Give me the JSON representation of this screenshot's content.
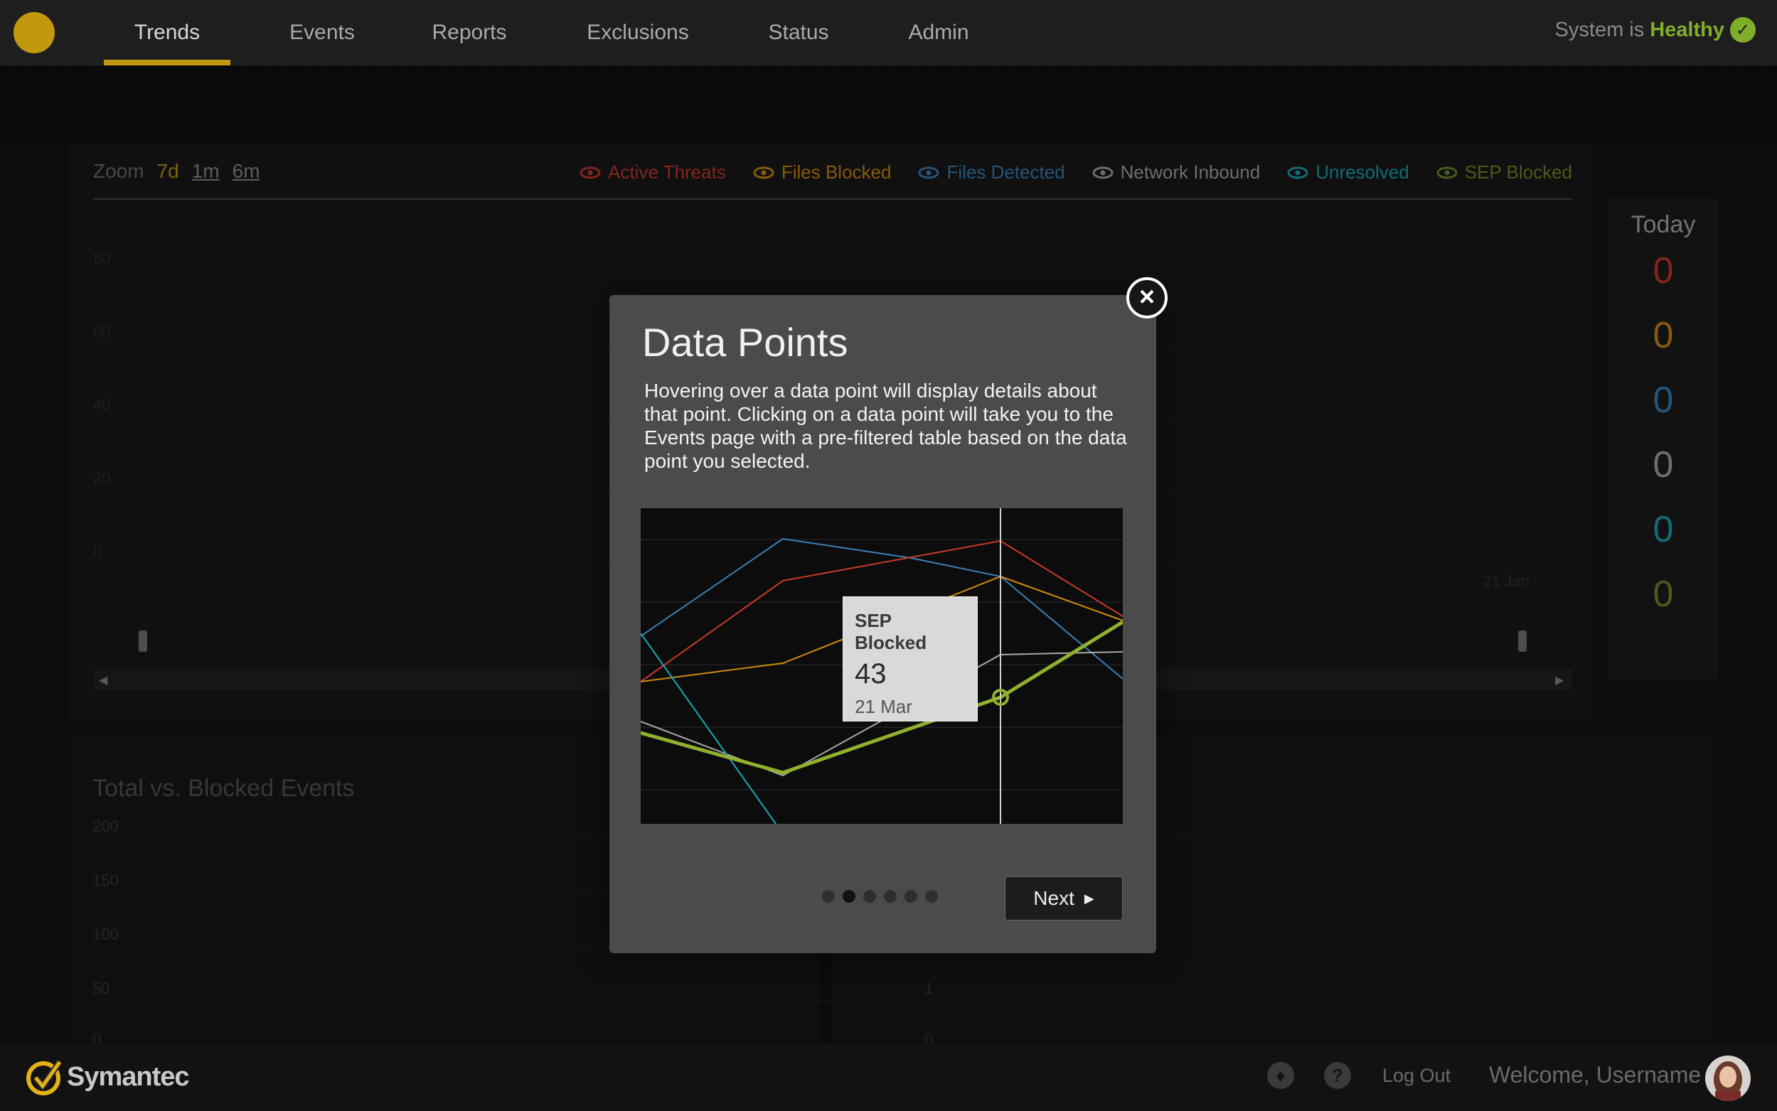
{
  "nav": {
    "items": [
      {
        "label": "Trends"
      },
      {
        "label": "Events"
      },
      {
        "label": "Reports"
      },
      {
        "label": "Exclusions"
      },
      {
        "label": "Status"
      },
      {
        "label": "Admin"
      }
    ],
    "active": "Trends",
    "status_prefix": "System is",
    "status_value": "Healthy"
  },
  "trend_panel": {
    "zoom_label": "Zoom",
    "zoom_options": [
      "7d",
      "1m",
      "6m"
    ],
    "zoom_selected": "7d",
    "legend": [
      {
        "label": "Active Threats",
        "color": "#c8392b"
      },
      {
        "label": "Files Blocked",
        "color": "#d08a10"
      },
      {
        "label": "Files Detected",
        "color": "#3a82b8"
      },
      {
        "label": "Network Inbound",
        "color": "#a8a8a8"
      },
      {
        "label": "Unresolved",
        "color": "#1aa6b6"
      },
      {
        "label": "SEP Blocked",
        "color": "#6f8d2a"
      }
    ],
    "y_ticks": [
      "80",
      "60",
      "40",
      "20",
      "0"
    ],
    "x_tick": "21 Jan"
  },
  "today": {
    "title": "Today",
    "values": [
      {
        "value": "0",
        "color": "#c8392b"
      },
      {
        "value": "0",
        "color": "#d08a10"
      },
      {
        "value": "0",
        "color": "#3a82b8"
      },
      {
        "value": "0",
        "color": "#a8a8a8"
      },
      {
        "value": "0",
        "color": "#1aa6b6"
      },
      {
        "value": "0",
        "color": "#6f8d2a"
      }
    ]
  },
  "lower_panel": {
    "title": "Total vs. Blocked Events",
    "left_ticks": [
      "200",
      "150",
      "100",
      "50",
      "0"
    ],
    "right_ticks": [
      "1",
      "0"
    ]
  },
  "modal": {
    "title": "Data Points",
    "body": "Hovering over a data point will display details about that point. Clicking on a data point will take you to the Events page with a pre-filtered table based on the data point you selected.",
    "tooltip": {
      "name": "SEP Blocked",
      "value": "43",
      "date": "21 Mar"
    },
    "page_count": 6,
    "current_page": 2,
    "next_label": "Next"
  },
  "footer": {
    "brand": "Symantec",
    "logout": "Log Out",
    "welcome": "Welcome, Username"
  }
}
